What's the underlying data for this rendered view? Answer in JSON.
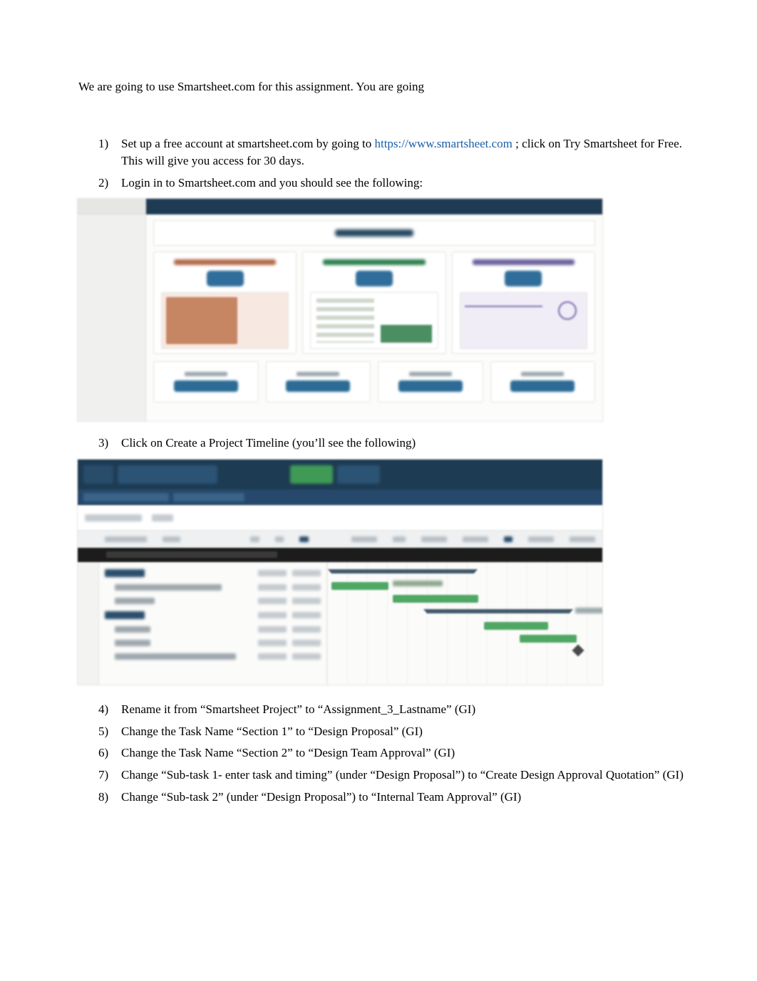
{
  "intro": "We are going to use Smartsheet.com for this assignment. You are going",
  "items": {
    "i1": {
      "num": "1)",
      "pre": "Set up a free account at smartsheet.com by going to ",
      "link": "https://www.smartsheet.com",
      "post": " ; click on Try Smartsheet for Free. This will give you access for 30 days."
    },
    "i2": {
      "num": "2)",
      "text": "Login in to Smartsheet.com and you should see the following:"
    },
    "i3": {
      "num": "3)",
      "text": "Click on Create a Project Timeline (you’ll see the following)"
    },
    "i4": {
      "num": "4)",
      "text": "Rename it from “Smartsheet Project” to “Assignment_3_Lastname”  (GI)"
    },
    "i5": {
      "num": "5)",
      "text": "Change the Task Name “Section 1” to “Design Proposal” (GI)"
    },
    "i6": {
      "num": "6)",
      "text": "Change the Task Name “Section 2” to “Design Team Approval” (GI)"
    },
    "i7": {
      "num": "7)",
      "text": "Change “Sub-task 1- enter task and timing”  (under “Design Proposal”) to “Create Design Approval Quotation” (GI)"
    },
    "i8": {
      "num": "8)",
      "text": "Change “Sub-task 2” (under “Design Proposal”) to “Internal Team Approval” (GI)"
    }
  }
}
